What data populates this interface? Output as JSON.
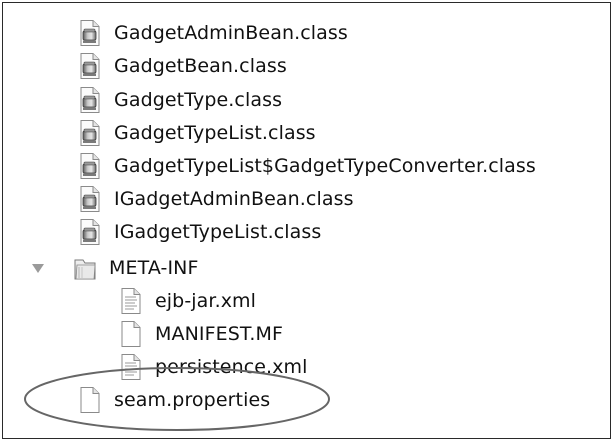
{
  "file_tree": {
    "items": [
      {
        "name": "GadgetAdminBean.class",
        "icon": "class-file-icon"
      },
      {
        "name": "GadgetBean.class",
        "icon": "class-file-icon"
      },
      {
        "name": "GadgetType.class",
        "icon": "class-file-icon"
      },
      {
        "name": "GadgetTypeList.class",
        "icon": "class-file-icon"
      },
      {
        "name": "GadgetTypeList$GadgetTypeConverter.class",
        "icon": "class-file-icon"
      },
      {
        "name": "IGadgetAdminBean.class",
        "icon": "class-file-icon"
      },
      {
        "name": "IGadgetTypeList.class",
        "icon": "class-file-icon"
      },
      {
        "name": "META-INF",
        "icon": "folder-icon",
        "expanded": true
      },
      {
        "name": "ejb-jar.xml",
        "icon": "text-document-icon"
      },
      {
        "name": "MANIFEST.MF",
        "icon": "blank-document-icon"
      },
      {
        "name": "persistence.xml",
        "icon": "text-document-icon"
      },
      {
        "name": "seam.properties",
        "icon": "blank-document-icon",
        "circled": true
      }
    ]
  },
  "colors": {
    "border": "#2a2a2a",
    "text": "#111111",
    "annotation": "#666666"
  }
}
